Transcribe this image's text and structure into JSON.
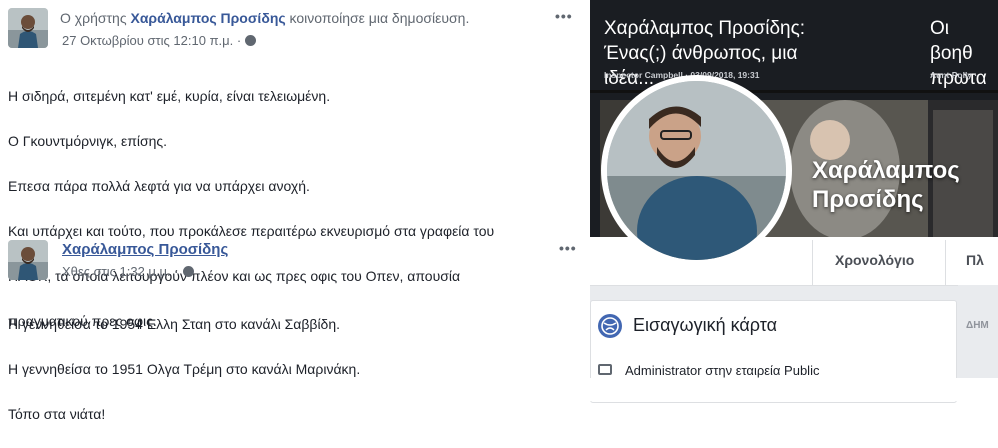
{
  "post1": {
    "prefix": "Ο χρήστης",
    "author": "Χαράλαμπος Προσίδης",
    "suffix": "κοινοποίησε μια δημοσίευση.",
    "timestamp": "27 Οκτωβρίου στις 12:10 π.μ. ·",
    "lines": [
      "Η σιδηρά, σιτεμένη κατ' εμέ, κυρία, είναι τελειωμένη.",
      "Ο Γκουντμόρνιγκ, επίσης.",
      "Επεσα πάρα πολλά λεφτά για να υπάρχει ανοχή.",
      "Και υπάρχει και τούτο, που προκάλεσε περαιτέρω εκνευρισμό στα γραφεία του",
      "ΠΑΟΚ, τα οποία λειτουργούν πλέον και ως πρες οφις του Οπεν, απουσία",
      "πραγματικού πρες οφις."
    ],
    "more": "•••"
  },
  "post2": {
    "author": "Χαράλαμπος Προσίδης",
    "timestamp": "Χθες στις 1:32 μ.μ. ·",
    "lines": [
      "Η γεννηθείσα το 1954 Ελλη Σταη στο κανάλι Σαββίδη.",
      "Η γεννηθείσα το 1951 Ολγα Τρέμη στο κανάλι Μαρινάκη.",
      "Τόπο στα νιάτα!"
    ],
    "more": "•••"
  },
  "profile": {
    "cards": [
      {
        "title": "Χαράλαμπος Προσίδης: Ένας(;) άνθρωπος, μια ιδέα...",
        "meta": "Inspector Campbell · 03/09/2018, 19:31"
      },
      {
        "title": "Οι βοηθ πρωτα",
        "meta": "Aunt Polly ·"
      }
    ],
    "name": "Χαράλαμπος Προσίδης",
    "tabs": [
      "Χρονολόγιο",
      "Πλ"
    ],
    "intro_title": "Εισαγωγική κάρτα",
    "intro_item": "Administrator στην εταιρεία Public",
    "side_label": "ΔΗΜ"
  },
  "colors": {
    "link": "#385898",
    "meta": "#606770",
    "fb_blue": "#4267b2"
  }
}
